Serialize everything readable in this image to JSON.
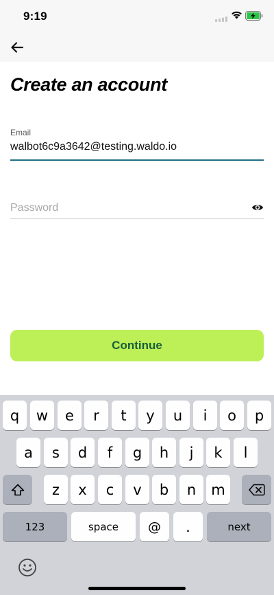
{
  "status_bar": {
    "time": "9:19"
  },
  "icons": {
    "back": "arrow-left-icon",
    "eye": "eye-icon",
    "shift": "shift-icon",
    "backspace": "backspace-icon",
    "emoji": "emoji-icon",
    "wifi": "wifi-icon",
    "battery": "battery-charging-icon",
    "signal": "signal-icon"
  },
  "page": {
    "title": "Create an account"
  },
  "email": {
    "label": "Email",
    "value": "walbot6c9a3642@testing.waldo.io"
  },
  "password": {
    "placeholder": "Password"
  },
  "continue_label": "Continue",
  "colors": {
    "accent_button": "#bdef56",
    "button_text": "#175f3c",
    "focus_underline": "#1f6f86",
    "keyboard_bg": "#d1d3d9"
  },
  "keyboard": {
    "row1": [
      "q",
      "w",
      "e",
      "r",
      "t",
      "y",
      "u",
      "i",
      "o",
      "p"
    ],
    "row2": [
      "a",
      "s",
      "d",
      "f",
      "g",
      "h",
      "j",
      "k",
      "l"
    ],
    "row3": [
      "z",
      "x",
      "c",
      "v",
      "b",
      "n",
      "m"
    ],
    "numbers_label": "123",
    "space_label": "space",
    "at_label": "@",
    "dot_label": ".",
    "next_label": "next"
  }
}
